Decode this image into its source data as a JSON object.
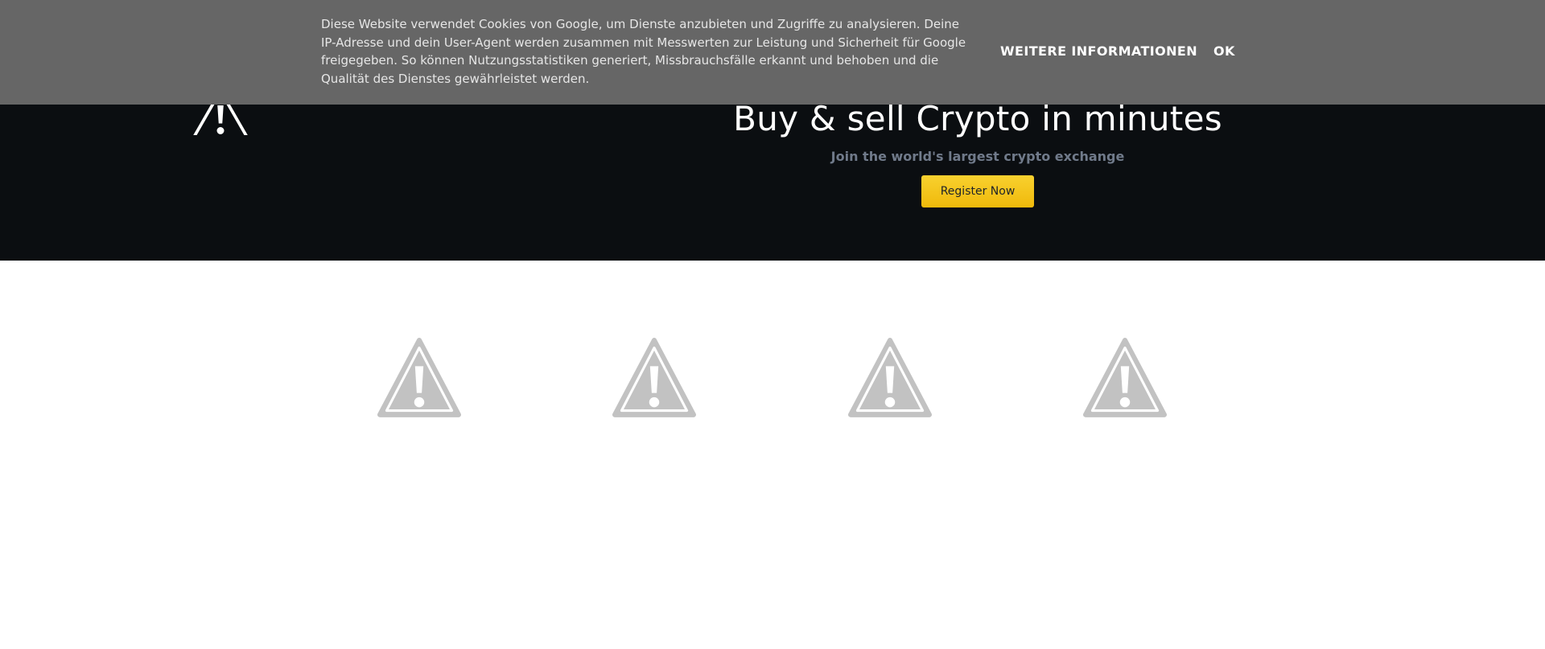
{
  "cookie_banner": {
    "text": "Diese Website verwendet Cookies von Google, um Dienste anzubieten und Zugriffe zu analysieren. Deine IP-Adresse und dein User-Agent werden zusammen mit Messwerten zur Leistung und Sicherheit für Google freigegeben. So können Nutzungsstatistiken generiert, Missbrauchsfälle erkannt und behoben und die Qualität des Dienstes gewährleistet werden.",
    "more_info_label": "WEITERE INFORMATIONEN",
    "ok_label": "OK"
  },
  "hero": {
    "title": "Buy & sell Crypto in minutes",
    "subtitle": "Join the world's largest crypto exchange",
    "register_label": "Register Now",
    "broken_image_icon": "warning-triangle-icon"
  },
  "features": {
    "images": [
      {
        "icon": "warning-triangle-icon"
      },
      {
        "icon": "warning-triangle-icon"
      },
      {
        "icon": "warning-triangle-icon"
      },
      {
        "icon": "warning-triangle-icon"
      }
    ]
  },
  "colors": {
    "hero_background": "#0b0e11",
    "cookie_background": "#666666",
    "accent_yellow": "#f0b90b",
    "subtitle_gray": "#707a8a",
    "broken_image_gray": "#c2c2c2"
  }
}
